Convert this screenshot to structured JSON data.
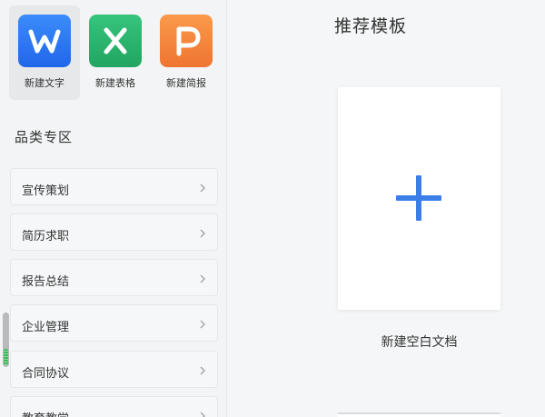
{
  "new_items": [
    {
      "label": "新建文字",
      "icon": "wps-writer-icon",
      "color": "#2f7df6"
    },
    {
      "label": "新建表格",
      "icon": "wps-spreadsheet-icon",
      "color": "#2fb36e"
    },
    {
      "label": "新建简报",
      "icon": "wps-presentation-icon",
      "color": "#f2883d"
    }
  ],
  "sidebar": {
    "section_title": "品类专区",
    "categories": [
      {
        "label": "宣传策划"
      },
      {
        "label": "简历求职"
      },
      {
        "label": "报告总结"
      },
      {
        "label": "企业管理"
      },
      {
        "label": "合同协议"
      },
      {
        "label": "教育教学"
      }
    ]
  },
  "main": {
    "title": "推荐模板",
    "blank_card_label": "新建空白文档",
    "accent_color": "#3b7ee8"
  }
}
